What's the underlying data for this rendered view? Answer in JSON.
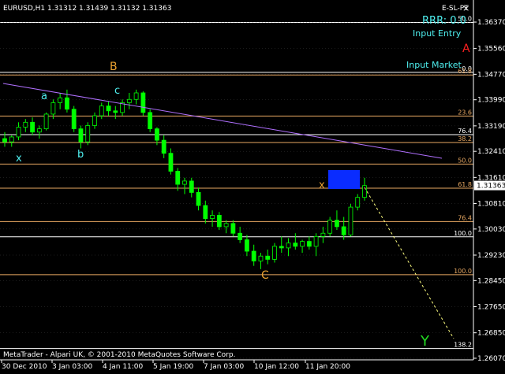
{
  "header": {
    "symbol_info": "EURUSD,H1  1.31312 1.31439 1.31132 1.31363",
    "indicator_name": "E-SL-PT",
    "close_glyph": "×"
  },
  "panel": {
    "rrr": "RRR: 0.0",
    "input_entry": "Input Entry",
    "input_market": "Input Market",
    "label_A": "A",
    "label_B": "B",
    "label_C": "C",
    "label_Y": "Y",
    "label_a": "a",
    "label_b": "b",
    "label_c": "c",
    "label_x1": "x",
    "label_x2": "x"
  },
  "footer": {
    "copyright": "MetaTrader - Alpari UK, © 2001-2010 MetaQuotes Software Corp."
  },
  "colors": {
    "background": "#000000",
    "grid": "#3a3a3a",
    "candle": "#00ff00",
    "axis_text": "#ffffff",
    "fib_orange": "#e8a862",
    "fib_white": "#ffffff",
    "trendline": "#b070ff",
    "projection": "#ffff80",
    "entry_box": "#0a2cff",
    "cyan_text": "#4ff0f0",
    "red_label": "#ff2020",
    "green_label": "#22dd22",
    "wave_label_orange": "#e8a030"
  },
  "chart_data": {
    "type": "candlestick",
    "title": "EURUSD,H1",
    "current_price": 1.31363,
    "ylim": [
      1.2607,
      1.3695
    ],
    "y_ticks": [
      1.3637,
      1.3556,
      1.3477,
      1.3399,
      1.3319,
      1.3241,
      1.3161,
      1.3081,
      1.3003,
      1.2923,
      1.2845,
      1.2765,
      1.2685,
      1.2607
    ],
    "y_tick_labels": [
      "1.36370",
      "1.35560",
      "1.34770",
      "1.33990",
      "1.33190",
      "1.32410",
      "1.31610",
      "1.30810",
      "1.30030",
      "1.29230",
      "1.28450",
      "1.27650",
      "1.26850",
      "1.26070"
    ],
    "x_tick_labels": [
      "30 Dec 2010",
      "3 Jan 03:00",
      "4 Jan 11:00",
      "5 Jan 19:00",
      "7 Jan 03:00",
      "10 Jan 12:00",
      "11 Jan 20:00"
    ],
    "fib_levels": [
      {
        "label": "50.0",
        "price": 1.3636,
        "color": "white"
      },
      {
        "label": "0.0",
        "price": 1.3483,
        "color": "white"
      },
      {
        "label": "61.8",
        "price": 1.3475,
        "color": "orange"
      },
      {
        "label": "23.6",
        "price": 1.3349,
        "color": "orange"
      },
      {
        "label": "76.4",
        "price": 1.3292,
        "color": "white"
      },
      {
        "label": "38.2",
        "price": 1.3268,
        "color": "orange"
      },
      {
        "label": "50.0",
        "price": 1.3202,
        "color": "orange"
      },
      {
        "label": "61.8",
        "price": 1.3128,
        "color": "orange"
      },
      {
        "label": "76.4",
        "price": 1.3026,
        "color": "orange"
      },
      {
        "label": "100.0",
        "price": 1.2979,
        "color": "white"
      },
      {
        "label": "100.0",
        "price": 1.2863,
        "color": "orange"
      },
      {
        "label": "138.2",
        "price": 1.2637,
        "color": "white"
      }
    ],
    "candles": [
      [
        1.328,
        1.33,
        1.3255,
        1.327
      ],
      [
        1.327,
        1.329,
        1.3255,
        1.3285
      ],
      [
        1.3285,
        1.333,
        1.3275,
        1.3315
      ],
      [
        1.3315,
        1.334,
        1.33,
        1.333
      ],
      [
        1.333,
        1.3345,
        1.329,
        1.33
      ],
      [
        1.33,
        1.332,
        1.328,
        1.331
      ],
      [
        1.331,
        1.336,
        1.3305,
        1.3355
      ],
      [
        1.3355,
        1.34,
        1.334,
        1.339
      ],
      [
        1.339,
        1.342,
        1.337,
        1.3405
      ],
      [
        1.3405,
        1.343,
        1.336,
        1.337
      ],
      [
        1.337,
        1.338,
        1.33,
        1.331
      ],
      [
        1.331,
        1.332,
        1.325,
        1.327
      ],
      [
        1.327,
        1.333,
        1.326,
        1.332
      ],
      [
        1.332,
        1.336,
        1.331,
        1.335
      ],
      [
        1.335,
        1.339,
        1.334,
        1.338
      ],
      [
        1.338,
        1.3395,
        1.335,
        1.3365
      ],
      [
        1.3365,
        1.338,
        1.334,
        1.336
      ],
      [
        1.336,
        1.34,
        1.335,
        1.339
      ],
      [
        1.339,
        1.342,
        1.337,
        1.34
      ],
      [
        1.34,
        1.343,
        1.3385,
        1.342
      ],
      [
        1.342,
        1.3425,
        1.335,
        1.336
      ],
      [
        1.336,
        1.337,
        1.33,
        1.331
      ],
      [
        1.331,
        1.3315,
        1.326,
        1.3275
      ],
      [
        1.3275,
        1.329,
        1.322,
        1.3235
      ],
      [
        1.3235,
        1.325,
        1.317,
        1.318
      ],
      [
        1.318,
        1.319,
        1.312,
        1.314
      ],
      [
        1.314,
        1.316,
        1.311,
        1.315
      ],
      [
        1.315,
        1.316,
        1.31,
        1.3115
      ],
      [
        1.3115,
        1.313,
        1.306,
        1.3075
      ],
      [
        1.3075,
        1.309,
        1.302,
        1.3035
      ],
      [
        1.3035,
        1.306,
        1.301,
        1.3045
      ],
      [
        1.3045,
        1.3055,
        1.3,
        1.301
      ],
      [
        1.301,
        1.303,
        1.299,
        1.302
      ],
      [
        1.302,
        1.303,
        1.298,
        1.299
      ],
      [
        1.299,
        1.301,
        1.296,
        1.297
      ],
      [
        1.297,
        1.2985,
        1.292,
        1.2935
      ],
      [
        1.2935,
        1.2955,
        1.289,
        1.2905
      ],
      [
        1.2905,
        1.293,
        1.288,
        1.292
      ],
      [
        1.292,
        1.294,
        1.2895,
        1.291
      ],
      [
        1.291,
        1.296,
        1.29,
        1.295
      ],
      [
        1.295,
        1.298,
        1.293,
        1.2945
      ],
      [
        1.2945,
        1.2975,
        1.292,
        1.296
      ],
      [
        1.296,
        1.299,
        1.294,
        1.295
      ],
      [
        1.295,
        1.297,
        1.293,
        1.2965
      ],
      [
        1.2965,
        1.298,
        1.294,
        1.295
      ],
      [
        1.295,
        1.299,
        1.292,
        1.298
      ],
      [
        1.298,
        1.301,
        1.296,
        1.299
      ],
      [
        1.299,
        1.304,
        1.298,
        1.303
      ],
      [
        1.303,
        1.306,
        1.3,
        1.301
      ],
      [
        1.301,
        1.304,
        1.297,
        1.2985
      ],
      [
        1.2985,
        1.308,
        1.298,
        1.307
      ],
      [
        1.307,
        1.311,
        1.306,
        1.31
      ],
      [
        1.31,
        1.316,
        1.309,
        1.3136
      ]
    ]
  }
}
